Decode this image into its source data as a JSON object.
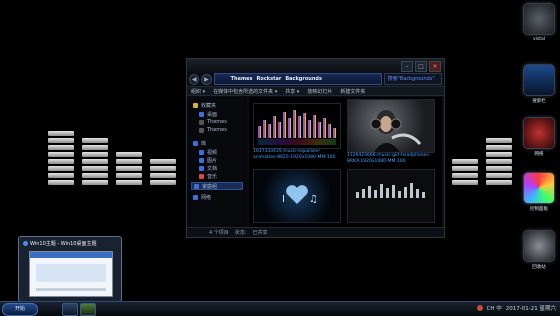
{
  "explorer": {
    "breadcrumbs": [
      "Themes",
      "Rockstar",
      "Backgrounds"
    ],
    "search_placeholder": "搜索\"Backgrounds\"",
    "toolbar": [
      "组织 ▾",
      "在媒体中包含所选的文件夹 ▾",
      "共享 ▾",
      "放映幻灯片",
      "新建文件夹"
    ],
    "nav": {
      "favorites_label": "收藏夹",
      "favorites": [
        "桌面",
        "Themes",
        "Themes"
      ],
      "libraries_label": "库",
      "libraries": [
        "视频",
        "图片",
        "文档",
        "音乐"
      ],
      "homegroup": "家庭组",
      "network": "网络"
    },
    "files": [
      {
        "name": "1037333435-music-equalizer-animation-8625-1920x1080-MM-100"
      },
      {
        "name": "1126423666-music-girl-headphones-8RKX-1920x1080-MM-100"
      },
      {
        "name": ""
      },
      {
        "name": ""
      }
    ],
    "status": {
      "count": "4 个项目",
      "state": "状态:",
      "shared": "已共享"
    }
  },
  "gadgets": [
    {
      "label": "vistal",
      "icon": "computer-icon"
    },
    {
      "label": "搜索栏",
      "icon": "equalizer-icon"
    },
    {
      "label": "网络",
      "icon": "network-icon"
    },
    {
      "label": "控制面板",
      "icon": "control-panel-icon"
    },
    {
      "label": "回收站",
      "icon": "recycle-bin-icon"
    }
  ],
  "preview": {
    "title": "Win10主题 - Win10桌面主题"
  },
  "taskbar": {
    "start_label": "开始",
    "clock": "2017-01-21  星期六",
    "tray_text": "CH 中"
  },
  "colors": {
    "accent": "#3fa2ff",
    "background": "#000000"
  }
}
